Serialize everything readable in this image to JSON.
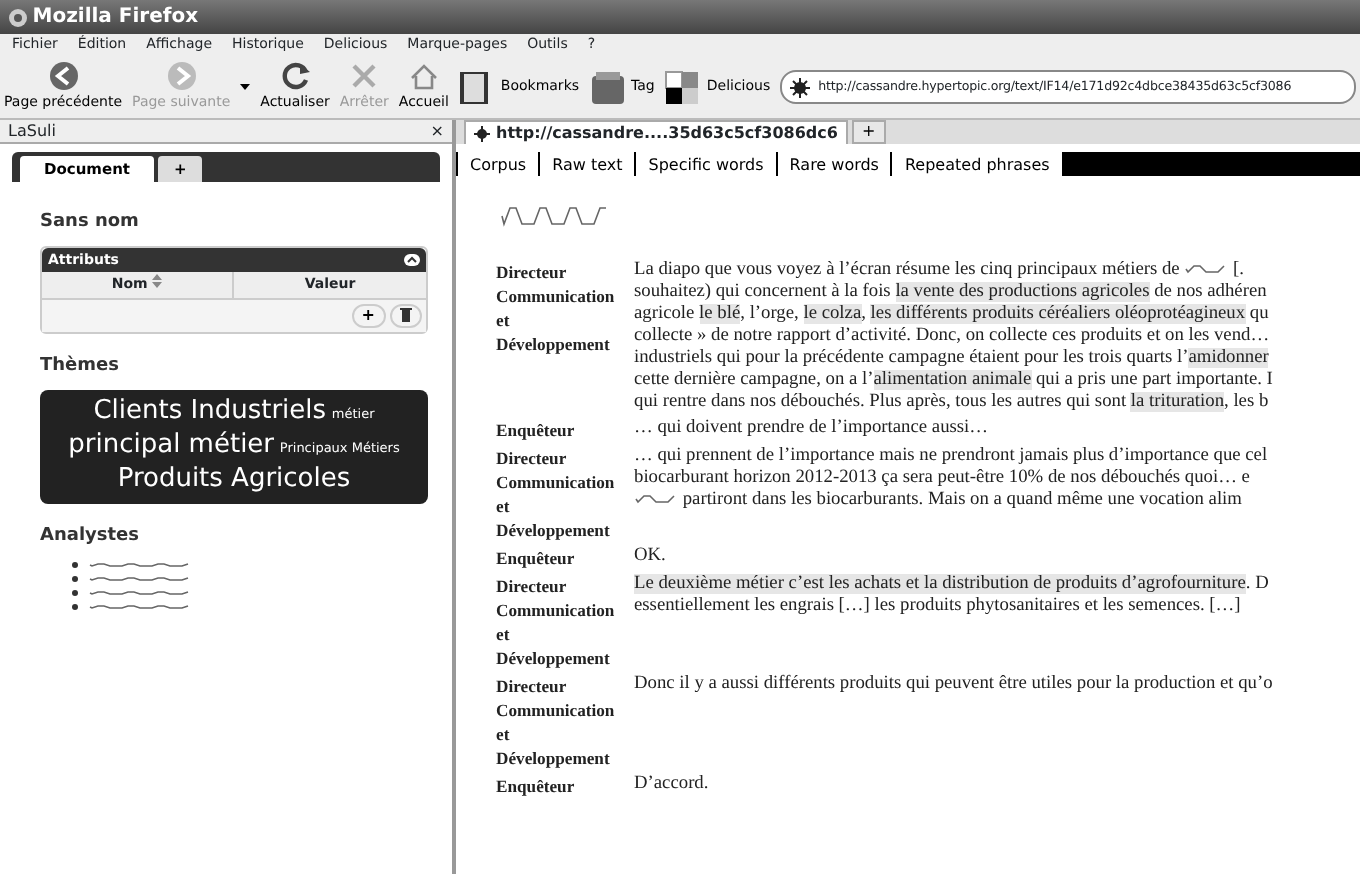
{
  "window": {
    "title": "Mozilla Firefox"
  },
  "menu": [
    "Fichier",
    "Édition",
    "Affichage",
    "Historique",
    "Delicious",
    "Marque-pages",
    "Outils",
    "?"
  ],
  "toolbar": [
    {
      "kind": "back",
      "label": "Page précédente",
      "disabled": false
    },
    {
      "kind": "forward",
      "label": "Page suivante",
      "disabled": true
    },
    {
      "kind": "dropdown"
    },
    {
      "kind": "reload",
      "label": "Actualiser",
      "disabled": false
    },
    {
      "kind": "stop",
      "label": "Arrêter",
      "disabled": true
    },
    {
      "kind": "home",
      "label": "Accueil",
      "disabled": false
    }
  ],
  "bookmarks": [
    {
      "kind": "book",
      "label": "Bookmarks"
    },
    {
      "kind": "tag",
      "label": "Tag"
    },
    {
      "kind": "delicious",
      "label": "Delicious"
    }
  ],
  "url": "http://cassandre.hypertopic.org/text/IF14/e171d92c4dbce38435d63c5cf3086",
  "sidebar": {
    "title": "LaSuli",
    "close": "×",
    "tabs": [
      {
        "label": "Document",
        "selected": true
      },
      {
        "label": "+",
        "selected": false
      }
    ],
    "document_name": "Sans nom",
    "attributes": {
      "title": "Attributs",
      "columns": [
        "Nom",
        "Valeur"
      ],
      "add": "+"
    },
    "themes_heading": "Thèmes",
    "themes": [
      {
        "label": "Clients Industriels",
        "large": true
      },
      {
        "label": "métier",
        "large": false
      },
      {
        "label": "principal métier",
        "large": true
      },
      {
        "label": "Principaux Métiers",
        "large": false
      },
      {
        "label": "Produits Agricoles",
        "large": true
      }
    ],
    "analysts_heading": "Analystes",
    "analysts": [
      {
        "kind": "redacted"
      },
      {
        "kind": "redacted"
      },
      {
        "kind": "redacted"
      },
      {
        "kind": "redacted"
      }
    ]
  },
  "browser_tabs": [
    {
      "label": "http://cassandre....35d63c5cf3086dc6",
      "selected": true
    }
  ],
  "new_tab": "+",
  "content_nav": [
    "Corpus",
    "Raw text",
    "Specific words",
    "Rare words",
    "Repeated phrases"
  ],
  "turns": [
    {
      "speaker": "Directeur Communication et Développement",
      "lines": [
        [
          {
            "kind": "plain",
            "text": "La diapo que vous voyez à l’écran résume les cinq principaux métiers de "
          },
          {
            "kind": "redacted"
          },
          {
            "kind": "plain",
            "text": " [."
          }
        ],
        [
          {
            "kind": "plain",
            "text": "souhaitez) qui concernent à la fois "
          },
          {
            "kind": "highlight",
            "text": "la vente des productions agricoles"
          },
          {
            "kind": "plain",
            "text": " de nos adhéren"
          }
        ],
        [
          {
            "kind": "plain",
            "text": "agricole "
          },
          {
            "kind": "highlight",
            "text": "le blé"
          },
          {
            "kind": "plain",
            "text": ", l’orge, "
          },
          {
            "kind": "highlight",
            "text": "le colza"
          },
          {
            "kind": "plain",
            "text": ", "
          },
          {
            "kind": "highlight",
            "text": "les différents produits céréaliers oléoprotéagineux"
          },
          {
            "kind": "plain",
            "text": " qu"
          }
        ],
        [
          {
            "kind": "plain",
            "text": "collecte » de notre rapport d’activité. Donc, on collecte ces produits et on les vend…"
          }
        ],
        [
          {
            "kind": "plain",
            "text": "industriels qui pour la précédente campagne étaient pour les trois quarts l’"
          },
          {
            "kind": "highlight",
            "text": "amidonner"
          }
        ],
        [
          {
            "kind": "plain",
            "text": "cette dernière campagne, on a l’"
          },
          {
            "kind": "highlight",
            "text": "alimentation animale"
          },
          {
            "kind": "plain",
            "text": " qui a pris une part importante. I"
          }
        ],
        [
          {
            "kind": "plain",
            "text": "qui rentre dans nos débouchés. Plus après, tous les autres qui sont "
          },
          {
            "kind": "highlight",
            "text": "la trituration"
          },
          {
            "kind": "plain",
            "text": ", les b"
          }
        ]
      ]
    },
    {
      "speaker": "Enquêteur",
      "lines": [
        [
          {
            "kind": "plain",
            "text": "… qui doivent prendre de l’importance aussi…"
          }
        ]
      ]
    },
    {
      "speaker": "Directeur Communication et Développement",
      "lines": [
        [
          {
            "kind": "plain",
            "text": "… qui prennent de l’importance mais ne prendront jamais plus d’importance que cel"
          }
        ],
        [
          {
            "kind": "plain",
            "text": "biocarburant horizon 2012-2013 ça sera peut-être 10% de nos débouchés quoi… e"
          }
        ],
        [
          {
            "kind": "redacted"
          },
          {
            "kind": "plain",
            "text": " partiront dans les biocarburants. Mais on a quand même une vocation alim"
          }
        ]
      ]
    },
    {
      "speaker": "Enquêteur",
      "lines": [
        [
          {
            "kind": "plain",
            "text": "OK."
          }
        ]
      ]
    },
    {
      "speaker": "Directeur Communication et Développement",
      "lines": [
        [
          {
            "kind": "highlight",
            "text": "Le deuxième métier c’est les achats et la distribution de produits d’agrofourniture"
          },
          {
            "kind": "plain",
            "text": ". D"
          }
        ],
        [
          {
            "kind": "plain",
            "text": "essentiellement les engrais […] les produits phytosanitaires et les semences. […]"
          }
        ]
      ]
    },
    {
      "speaker": "Directeur Communication et Développement",
      "lines": [
        [
          {
            "kind": "plain",
            "text": "Donc il y a aussi différents produits qui peuvent être utiles pour la production et qu’o"
          }
        ]
      ]
    },
    {
      "speaker": "Enquêteur",
      "lines": [
        [
          {
            "kind": "plain",
            "text": "D’accord."
          }
        ]
      ]
    }
  ]
}
